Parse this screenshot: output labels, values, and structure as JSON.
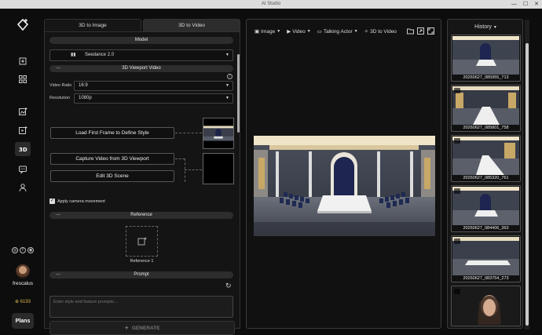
{
  "window": {
    "title": "AI Studio"
  },
  "rail": {
    "user_name": "frescalus",
    "credits": "6193",
    "plans_label": "Plans"
  },
  "left_panel": {
    "tabs": [
      {
        "label": "3D to Image",
        "active": false
      },
      {
        "label": "3D to Video",
        "active": true
      }
    ],
    "model_header": "Model",
    "model_value": "Seedance 2.0",
    "viewport_header": "3D Viewport Video",
    "video_ratio_label": "Video Ratio",
    "video_ratio_value": "16:9",
    "resolution_label": "Resolution",
    "resolution_value": "1080p",
    "load_first_frame_label": "Load First Frame to Define Style",
    "capture_video_label": "Capture Video from 3D Viewport",
    "edit_scene_label": "Edit 3D Scene",
    "apply_camera_label": "Apply camera movement",
    "apply_camera_checked": true,
    "reference_header": "Reference",
    "reference_item_label": "Reference 1",
    "prompt_header": "Prompt",
    "prompt_placeholder": "Enter style and feature prompts...",
    "generate_label": "GENERATE"
  },
  "center": {
    "toolbar": [
      {
        "label": "Image",
        "dropdown": true
      },
      {
        "label": "Video",
        "dropdown": true
      },
      {
        "label": "Talking Actor",
        "dropdown": true
      },
      {
        "label": "3D to Video",
        "dropdown": false
      }
    ]
  },
  "history": {
    "title": "History",
    "items": [
      {
        "caption": "20260627_085955_713"
      },
      {
        "caption": "20260627_085801_758"
      },
      {
        "caption": "20260627_085320_761"
      },
      {
        "caption": "20260627_084406_363"
      },
      {
        "caption": "20260627_083754_273"
      }
    ]
  },
  "colors": {
    "accent_credits": "#d8b14a",
    "background": "#0d0d0d"
  }
}
